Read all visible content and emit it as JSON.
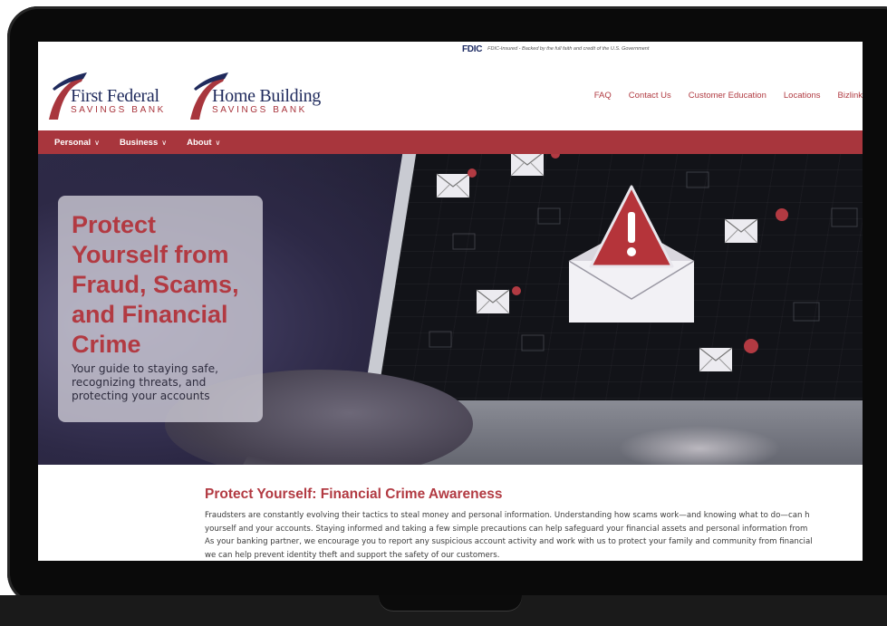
{
  "top_bar": {
    "fdic_logo": "FDIC",
    "fdic_text": "FDIC-Insured - Backed by the full faith and credit of the U.S. Government"
  },
  "brands": [
    {
      "name": "First Federal",
      "sub": "SAVINGS BANK"
    },
    {
      "name": "Home Building",
      "sub": "SAVINGS BANK"
    }
  ],
  "utility_nav": [
    "FAQ",
    "Contact Us",
    "Customer Education",
    "Locations",
    "Bizlink"
  ],
  "main_nav": [
    "Personal",
    "Business",
    "About"
  ],
  "hero": {
    "title": "Protect Yourself from Fraud, Scams, and Financial Crime",
    "subtitle": "Your guide to staying safe, recognizing threats, and protecting your accounts"
  },
  "content": {
    "title": "Protect Yourself: Financial Crime Awareness",
    "lines": [
      "Fraudsters are constantly evolving their tactics to steal money and personal information. Understanding how scams work—and knowing what to do—can h",
      "yourself and your accounts.  Staying informed and taking a few simple precautions can help safeguard your financial assets and personal information from",
      "As your banking partner, we encourage you to report any suspicious account activity and work with us to protect your family and community from financial",
      "we can help prevent identity theft and support the safety of our customers."
    ]
  },
  "colors": {
    "brand_red": "#a8363d",
    "brand_navy": "#1f2a5c",
    "device_bezel": "#0a0a0a"
  },
  "icons": {
    "nav_chevron": "chevron-down-icon",
    "alert": "warning-triangle-icon",
    "mail": "envelope-icon"
  }
}
